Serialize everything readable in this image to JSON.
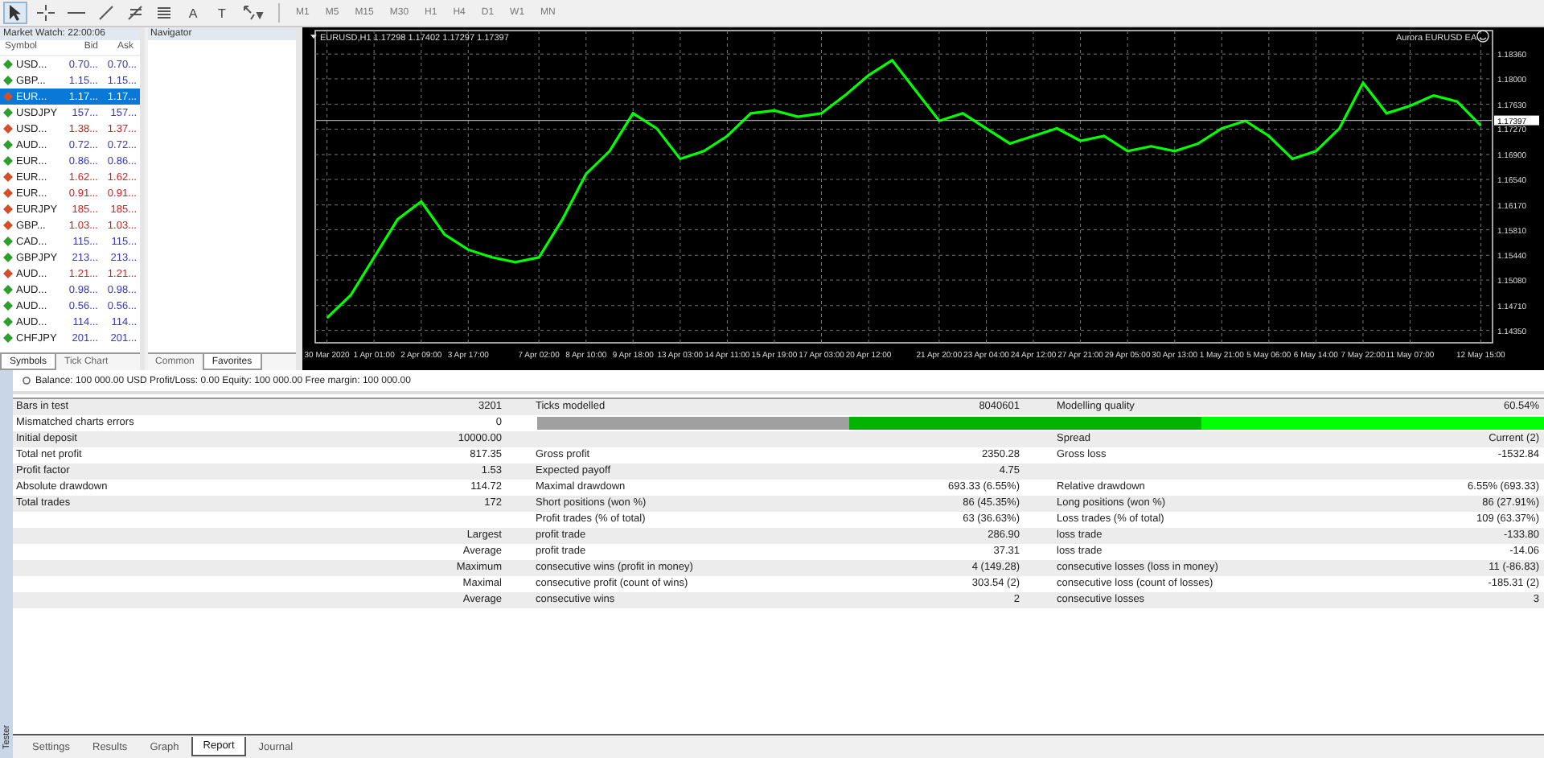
{
  "toolbar": {
    "tools": [
      {
        "kind": "cursor",
        "selected": true
      },
      {
        "kind": "crosshair",
        "selected": false
      },
      {
        "kind": "hline",
        "selected": false
      },
      {
        "kind": "trendline",
        "selected": false
      },
      {
        "kind": "fibo",
        "selected": false
      },
      {
        "kind": "channel",
        "selected": false
      },
      {
        "kind": "text",
        "label": "A",
        "selected": false
      },
      {
        "kind": "label",
        "label": "T",
        "selected": false
      },
      {
        "kind": "arrows",
        "selected": false
      }
    ],
    "timeframes": [
      "M1",
      "M5",
      "M15",
      "M30",
      "H1",
      "H4",
      "D1",
      "W1",
      "MN"
    ]
  },
  "market_watch": {
    "title": "Market Watch: 22:00:06",
    "columns": [
      "Symbol",
      "Bid",
      "Ask"
    ],
    "rows": [
      {
        "symbol": "USD...",
        "bid": "0.70...",
        "ask": "0.70...",
        "rising": true,
        "selected": false
      },
      {
        "symbol": "GBP...",
        "bid": "1.15...",
        "ask": "1.15...",
        "rising": true,
        "selected": false
      },
      {
        "symbol": "EUR...",
        "bid": "1.17...",
        "ask": "1.17...",
        "rising": false,
        "selected": true
      },
      {
        "symbol": "USDJPY",
        "bid": "157...",
        "ask": "157...",
        "rising": true,
        "selected": false
      },
      {
        "symbol": "USD...",
        "bid": "1.38...",
        "ask": "1.37...",
        "rising": false,
        "selected": false
      },
      {
        "symbol": "AUD...",
        "bid": "0.72...",
        "ask": "0.72...",
        "rising": true,
        "selected": false
      },
      {
        "symbol": "EUR...",
        "bid": "0.86...",
        "ask": "0.86...",
        "rising": true,
        "selected": false
      },
      {
        "symbol": "EUR...",
        "bid": "1.62...",
        "ask": "1.62...",
        "rising": false,
        "selected": false
      },
      {
        "symbol": "EUR...",
        "bid": "0.91...",
        "ask": "0.91...",
        "rising": false,
        "selected": false
      },
      {
        "symbol": "EURJPY",
        "bid": "185...",
        "ask": "185...",
        "rising": false,
        "selected": false
      },
      {
        "symbol": "GBP...",
        "bid": "1.03...",
        "ask": "1.03...",
        "rising": false,
        "selected": false
      },
      {
        "symbol": "CAD...",
        "bid": "115...",
        "ask": "115...",
        "rising": true,
        "selected": false
      },
      {
        "symbol": "GBPJPY",
        "bid": "213...",
        "ask": "213...",
        "rising": true,
        "selected": false
      },
      {
        "symbol": "AUD...",
        "bid": "1.21...",
        "ask": "1.21...",
        "rising": false,
        "selected": false
      },
      {
        "symbol": "AUD...",
        "bid": "0.98...",
        "ask": "0.98...",
        "rising": true,
        "selected": false
      },
      {
        "symbol": "AUD...",
        "bid": "0.56...",
        "ask": "0.56...",
        "rising": true,
        "selected": false
      },
      {
        "symbol": "AUD...",
        "bid": "114...",
        "ask": "114...",
        "rising": true,
        "selected": false
      },
      {
        "symbol": "CHFJPY",
        "bid": "201...",
        "ask": "201...",
        "rising": true,
        "selected": false
      }
    ],
    "tabs": [
      {
        "label": "Symbols",
        "selected": true
      },
      {
        "label": "Tick Chart",
        "selected": false
      }
    ]
  },
  "navigator": {
    "title": "Navigator",
    "tabs": [
      {
        "label": "Common",
        "selected": false
      },
      {
        "label": "Favorites",
        "selected": true
      }
    ]
  },
  "chart": {
    "symbol_info": "EURUSD,H1  1.17298 1.17402 1.17297 1.17397",
    "expert": "Aurora EURUSD EA",
    "chart_data": {
      "type": "line",
      "grid": true,
      "categories": [
        "30 Mar 2020",
        null,
        "1 Apr 01:00",
        null,
        "2 Apr 09:00",
        null,
        "3 Apr 17:00",
        null,
        null,
        "7 Apr 02:00",
        null,
        "8 Apr 10:00",
        null,
        "9 Apr 18:00",
        null,
        "13 Apr 03:00",
        null,
        "14 Apr 11:00",
        null,
        "15 Apr 19:00",
        null,
        "17 Apr 03:00",
        null,
        "20 Apr 12:00",
        null,
        null,
        "21 Apr 20:00",
        null,
        "23 Apr 04:00",
        null,
        "24 Apr 12:00",
        null,
        "27 Apr 21:00",
        null,
        "29 Apr 05:00",
        null,
        "30 Apr 13:00",
        null,
        "1 May 21:00",
        null,
        "5 May 06:00",
        null,
        "6 May 14:00",
        null,
        "7 May 22:00",
        null,
        "11 May 07:00",
        null,
        null,
        "12 May 15:00"
      ],
      "series": [
        {
          "color": "#00ff00",
          "values": [
            1.1453,
            1.1486,
            1.1541,
            1.1596,
            1.1622,
            1.1574,
            1.1552,
            1.1541,
            1.1534,
            1.1541,
            1.1596,
            1.1662,
            1.1695,
            1.175,
            1.1728,
            1.1684,
            1.1695,
            1.1717,
            1.175,
            1.1754,
            1.1745,
            1.175,
            1.1776,
            1.1805,
            1.1827,
            1.1783,
            1.1739,
            1.175,
            1.1728,
            1.1706,
            1.1717,
            1.1728,
            1.171,
            1.1717,
            1.1695,
            1.1702,
            1.1695,
            1.1706,
            1.1728,
            1.1739,
            1.1717,
            1.1684,
            1.1695,
            1.1728,
            1.1794,
            1.175,
            1.1761,
            1.1776,
            1.1767,
            1.1732
          ]
        }
      ],
      "ylim": [
        1.1417,
        1.187
      ],
      "yticks": [
        {
          "value": 1.1836,
          "label": "1.18360"
        },
        {
          "value": 1.18,
          "label": "1.18000"
        },
        {
          "value": 1.1763,
          "label": "1.17630"
        },
        {
          "value": 1.1727,
          "label": "1.17270"
        },
        {
          "value": 1.169,
          "label": "1.16900"
        },
        {
          "value": 1.1654,
          "label": "1.16540"
        },
        {
          "value": 1.1617,
          "label": "1.16170"
        },
        {
          "value": 1.1581,
          "label": "1.15810"
        },
        {
          "value": 1.1544,
          "label": "1.15440"
        },
        {
          "value": 1.1508,
          "label": "1.15080"
        },
        {
          "value": 1.1471,
          "label": "1.14710"
        },
        {
          "value": 1.1435,
          "label": "1.14350"
        }
      ],
      "ref_lines": [
        {
          "axis": "y",
          "value": 1.17397,
          "label": "1.17397"
        }
      ]
    }
  },
  "account_bar": {
    "text": "Balance: 100 000.00 USD  Profit/Loss: 0.00  Equity: 100 000.00  Free margin: 100 000.00"
  },
  "report": {
    "rows": [
      [
        "Bars in test",
        "3201",
        "Ticks modelled",
        "8040601",
        "Modelling quality",
        "60.54%"
      ],
      [
        "Mismatched charts errors",
        "0"
      ],
      [
        "Initial deposit",
        "10000.00",
        null,
        null,
        "Spread",
        "Current (2)"
      ],
      [
        "Total net profit",
        "817.35",
        "Gross profit",
        "2350.28",
        "Gross loss",
        "-1532.84"
      ],
      [
        "Profit factor",
        "1.53",
        "Expected payoff",
        "4.75",
        null,
        null
      ],
      [
        "Absolute drawdown",
        "114.72",
        "Maximal drawdown",
        "693.33 (6.55%)",
        "Relative drawdown",
        "6.55% (693.33)"
      ],
      [
        "Total trades",
        "172",
        "Short positions (won %)",
        "86 (45.35%)",
        "Long positions (won %)",
        "86 (27.91%)"
      ],
      [
        null,
        null,
        "Profit trades (% of total)",
        "63 (36.63%)",
        "Loss trades (% of total)",
        "109 (63.37%)"
      ],
      [
        null,
        "Largest",
        "profit trade",
        "286.90",
        "loss trade",
        "-133.80"
      ],
      [
        null,
        "Average",
        "profit trade",
        "37.31",
        "loss trade",
        "-14.06"
      ],
      [
        null,
        "Maximum",
        "consecutive wins (profit in money)",
        "4 (149.28)",
        "consecutive losses (loss in money)",
        "11 (-86.83)"
      ],
      [
        null,
        "Maximal",
        "consecutive profit (count of wins)",
        "303.54 (2)",
        "consecutive loss (count of losses)",
        "-185.31 (2)"
      ],
      [
        null,
        "Average",
        "consecutive wins",
        "2",
        "consecutive losses",
        "3"
      ]
    ],
    "quality_bar": [
      {
        "color": "#00b400",
        "level": 0.69
      },
      {
        "color": "#00ff00",
        "level": 0.34
      }
    ]
  },
  "tester": {
    "title": "Tester",
    "tabs": [
      {
        "label": "Settings",
        "selected": false
      },
      {
        "label": "Results",
        "selected": false
      },
      {
        "label": "Graph",
        "selected": false
      },
      {
        "label": "Report",
        "selected": true
      },
      {
        "label": "Journal",
        "selected": false
      }
    ]
  }
}
